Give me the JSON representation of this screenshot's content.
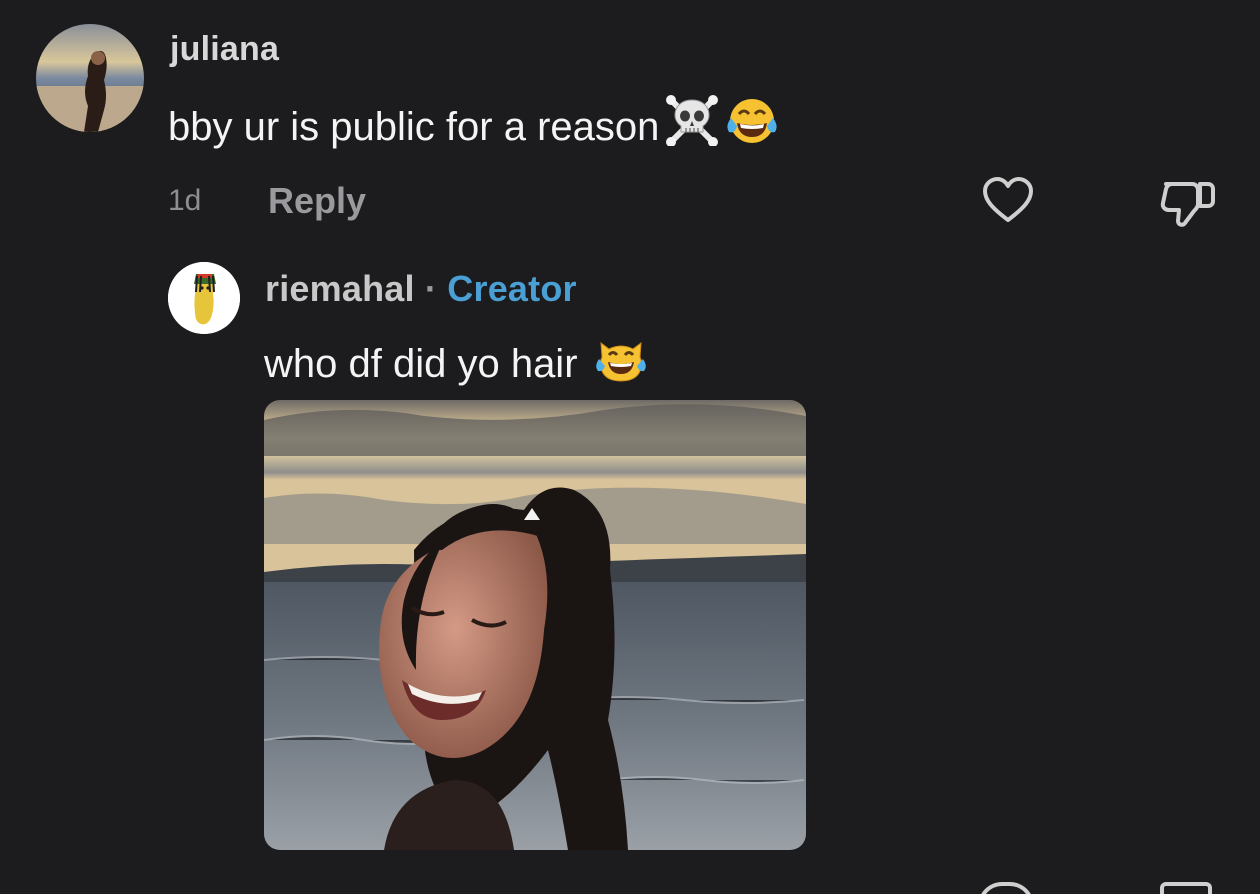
{
  "comment": {
    "username": "juliana",
    "text": "bby ur is public for a reason",
    "emojis": [
      "skull-crossbones-emoji",
      "tears-of-joy-emoji"
    ],
    "time": "1d",
    "reply_label": "Reply",
    "like_icon": "heart-icon",
    "dislike_icon": "thumbs-down-icon"
  },
  "reply": {
    "username": "riemahal",
    "separator": "·",
    "badge": "Creator",
    "text": "who df did yo hair",
    "emojis": [
      "cat-tears-of-joy-emoji"
    ]
  },
  "colors": {
    "background": "#1c1c1e",
    "creator_badge": "#4a9fd4",
    "muted": "#8e8e93"
  }
}
